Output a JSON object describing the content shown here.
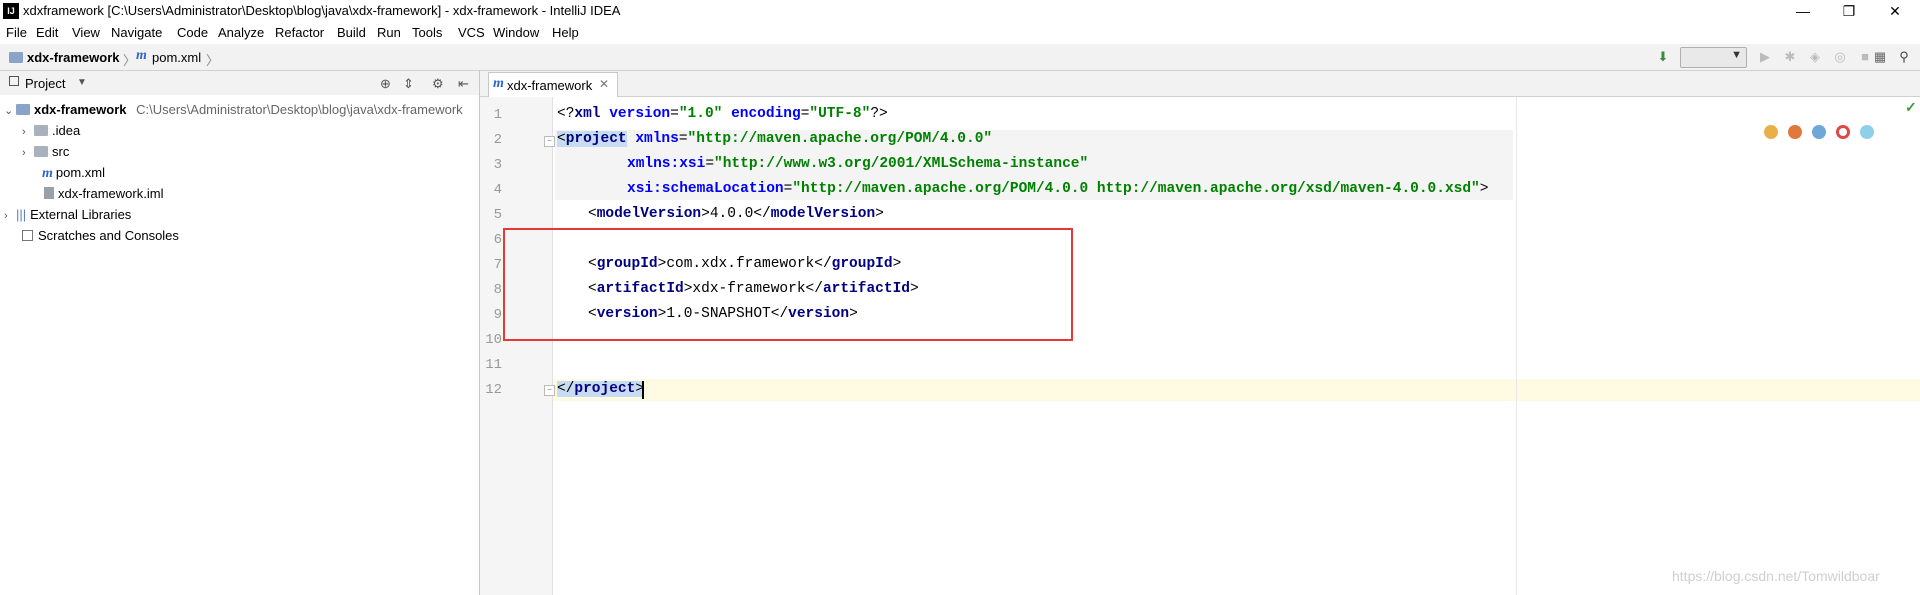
{
  "window": {
    "title": "xdxframework [C:\\Users\\Administrator\\Desktop\\blog\\java\\xdx-framework] - xdx-framework - IntelliJ IDEA",
    "app_icon_text": "IJ",
    "controls": {
      "minimize": "—",
      "maximize": "❐",
      "close": "✕"
    }
  },
  "menu": {
    "items": [
      "File",
      "Edit",
      "View",
      "Navigate",
      "Code",
      "Analyze",
      "Refactor",
      "Build",
      "Run",
      "Tools",
      "VCS",
      "Window",
      "Help"
    ]
  },
  "breadcrumbs": {
    "project": "xdx-framework",
    "file": "pom.xml",
    "separator": "〉"
  },
  "project_panel": {
    "title": "Project",
    "tree": [
      {
        "label": "xdx-framework",
        "path": "C:\\Users\\Administrator\\Desktop\\blog\\java\\xdx-framework",
        "expanded": true
      },
      {
        "label": ".idea"
      },
      {
        "label": "src"
      },
      {
        "label": "pom.xml"
      },
      {
        "label": "xdx-framework.iml"
      },
      {
        "label": "External Libraries"
      },
      {
        "label": "Scratches and Consoles"
      }
    ]
  },
  "editor": {
    "tab_label": "xdx-framework",
    "line_numbers": [
      "1",
      "2",
      "3",
      "4",
      "5",
      "6",
      "7",
      "8",
      "9",
      "10",
      "11",
      "12"
    ],
    "lines": {
      "l1": {
        "a": "<?",
        "b": "xml ",
        "c": "version",
        "d": "=",
        "e": "\"1.0\"",
        "f": " ",
        "g": "encoding",
        "h": "=",
        "i": "\"UTF-8\"",
        "j": "?>"
      },
      "l2": {
        "a": "<",
        "b": "project",
        "c": " ",
        "d": "xmlns",
        "e": "=",
        "f": "\"http://maven.apache.org/POM/4.0.0\""
      },
      "l3": {
        "a": "xmlns:xsi",
        "b": "=",
        "c": "\"http://www.w3.org/2001/XMLSchema-instance\""
      },
      "l4": {
        "a": "xsi:schemaLocation",
        "b": "=",
        "c": "\"http://maven.apache.org/POM/4.0.0 http://maven.apache.org/xsd/maven-4.0.0.xsd\"",
        "d": ">"
      },
      "l5": {
        "a": "<",
        "b": "modelVersion",
        "c": ">4.0.0</",
        "d": "modelVersion",
        "e": ">"
      },
      "l7": {
        "a": "<",
        "b": "groupId",
        "c": ">com.xdx.framework</",
        "d": "groupId",
        "e": ">"
      },
      "l8": {
        "a": "<",
        "b": "artifactId",
        "c": ">xdx-framework</",
        "d": "artifactId",
        "e": ">"
      },
      "l9": {
        "a": "<",
        "b": "version",
        "c": ">1.0-SNAPSHOT</",
        "d": "version",
        "e": ">"
      },
      "l12": {
        "a": "</",
        "b": "project",
        "c": ">"
      }
    }
  },
  "watermark": "https://blog.csdn.net/Tomwildboar",
  "colors": {
    "tag": "#000080",
    "attribute": "#0000ff",
    "string": "#008000",
    "annotation_box": "#e53935",
    "current_line": "#fffbe3"
  }
}
